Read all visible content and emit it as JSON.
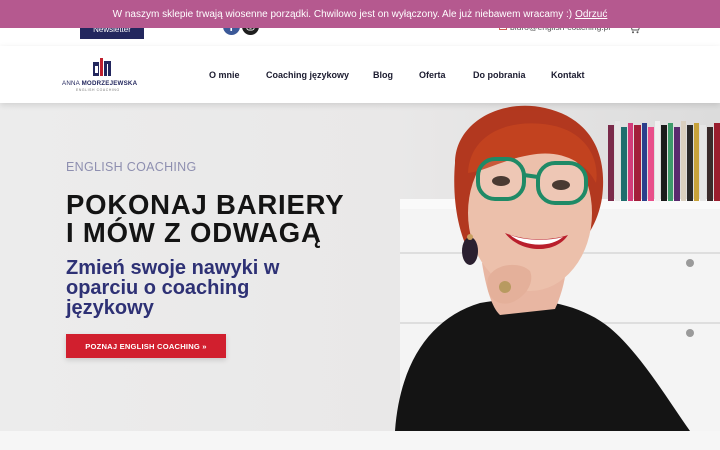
{
  "notice": {
    "message": "W naszym sklepie trwają wiosenne porządki. Chwilowo jest on wyłączony. Ale już niebawem wracamy :)",
    "dismiss_label": "Odrzuć"
  },
  "topbar": {
    "newsletter_label": "Newsletter",
    "email": "biuro@english-coaching.pl",
    "social_icons": [
      "facebook-icon",
      "instagram-icon"
    ],
    "cart_icon": "cart-icon"
  },
  "logo": {
    "name_first": "ANNA",
    "name_last": "MODRZEJEWSKA",
    "tagline": "ENGLISH COACHING"
  },
  "nav": {
    "items": [
      {
        "label": "O mnie"
      },
      {
        "label": "Coaching językowy"
      },
      {
        "label": "Blog"
      },
      {
        "label": "Oferta"
      },
      {
        "label": "Do pobrania"
      },
      {
        "label": "Kontakt"
      }
    ]
  },
  "hero": {
    "eyebrow": "ENGLISH COACHING",
    "headline_line1": "POKONAJ BARIERY",
    "headline_line2": "I MÓW Z ODWAGĄ",
    "subhead": "Zmień swoje nawyki w oparciu o coaching językowy",
    "cta_label": "POZNAJ ENGLISH COACHING »"
  },
  "colors": {
    "notice_bg": "#b5598f",
    "brand_navy": "#23275e",
    "subhead": "#2e3175",
    "cta": "#d11f2e"
  }
}
